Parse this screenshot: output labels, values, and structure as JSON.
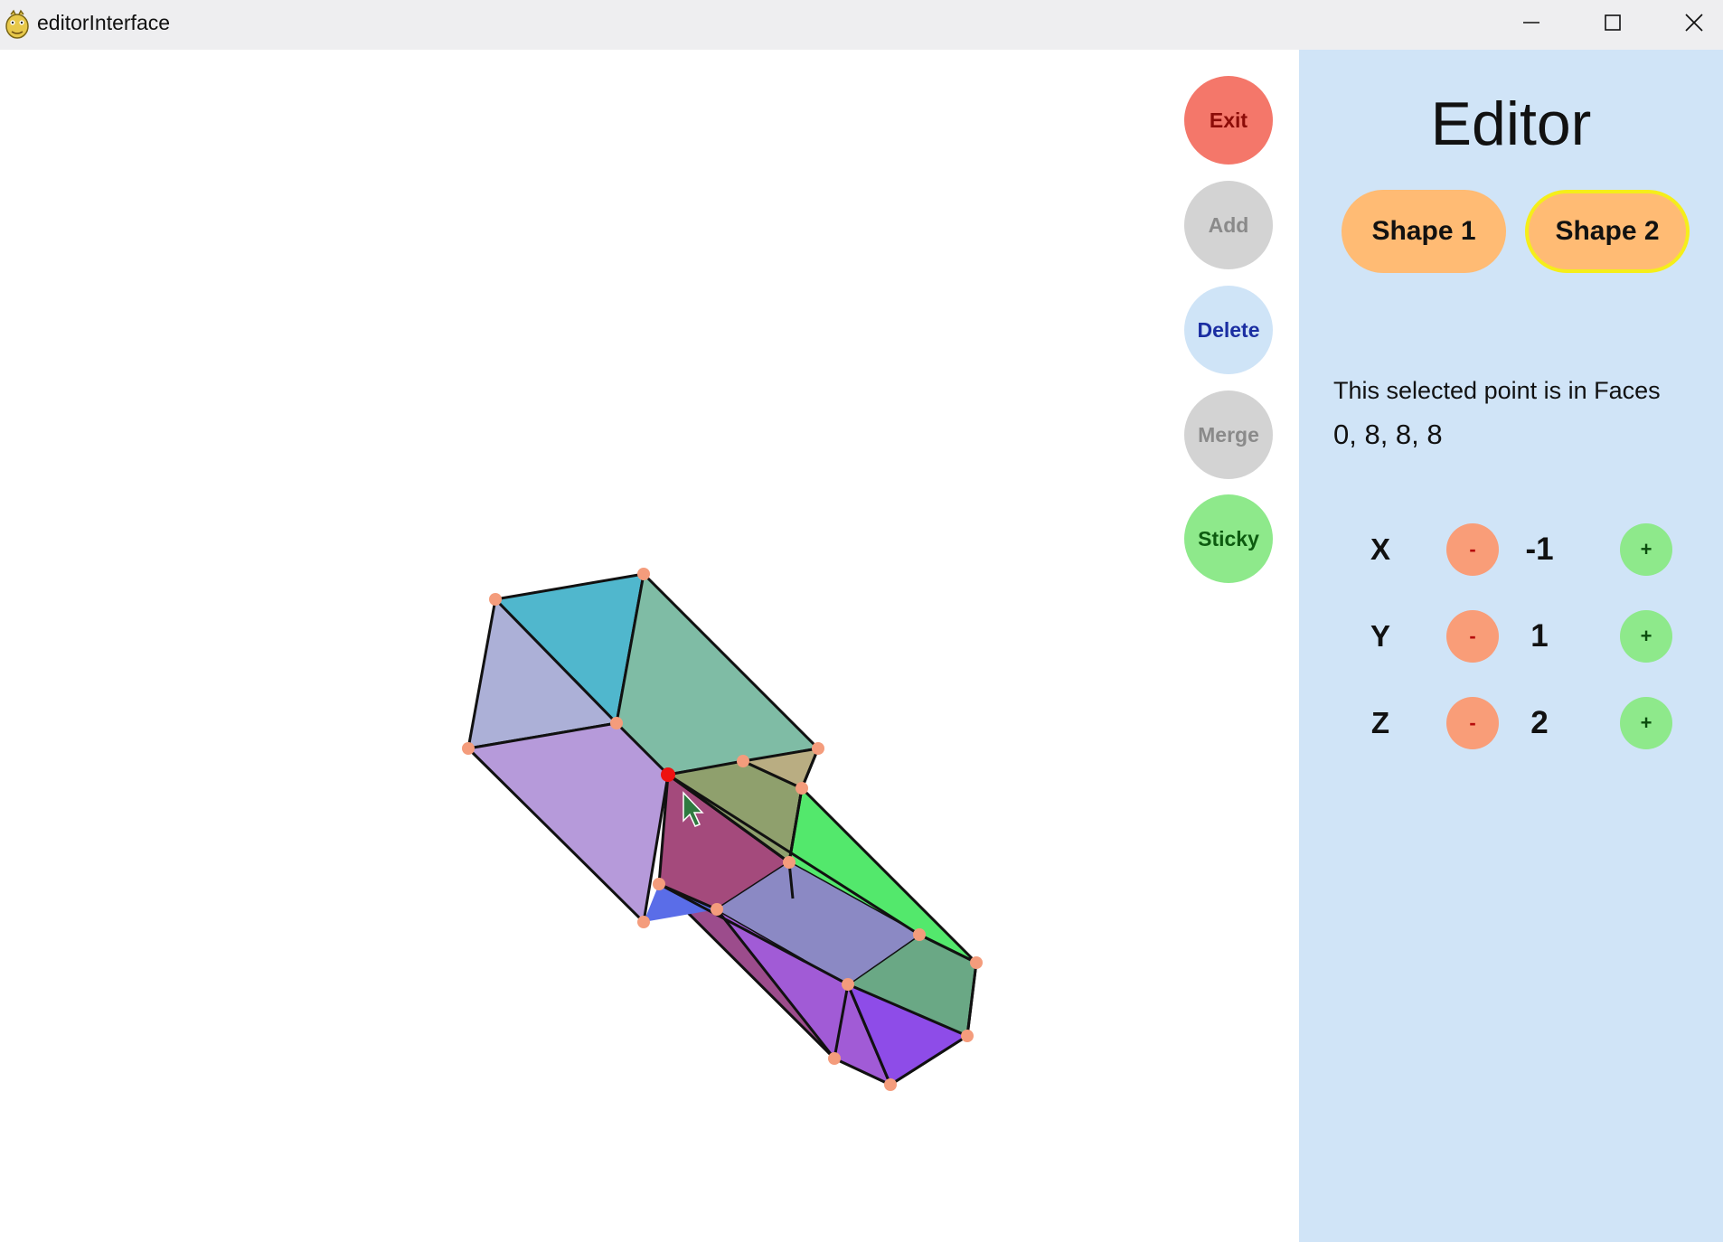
{
  "window": {
    "title": "editorInterface",
    "app_icon": "python-snake-icon",
    "controls": {
      "minimize": "minimize-icon",
      "maximize": "maximize-icon",
      "close": "close-icon"
    }
  },
  "tools": {
    "exit": "Exit",
    "add": "Add",
    "delete": "Delete",
    "merge": "Merge",
    "sticky": "Sticky"
  },
  "editor": {
    "title": "Editor",
    "shapes": [
      {
        "label": "Shape 1",
        "selected": false
      },
      {
        "label": "Shape 2",
        "selected": true
      }
    ],
    "info_line1": "This selected point is in Faces",
    "info_line2": "0, 8, 8, 8",
    "coords": [
      {
        "axis": "X",
        "minus": "-",
        "value": "-1",
        "plus": "+"
      },
      {
        "axis": "Y",
        "minus": "-",
        "value": "1",
        "plus": "+"
      },
      {
        "axis": "Z",
        "minus": "-",
        "value": "2",
        "plus": "+"
      }
    ]
  },
  "colors": {
    "panel_bg": "#d0e4f7",
    "exit": "#f4776a",
    "add": "#d3d3d3",
    "delete": "#cfe4f7",
    "merge": "#d3d3d3",
    "sticky": "#8ee98b",
    "shape_button": "#ffbb74",
    "shape_selected_border": "#f5ee1a",
    "minus_button": "#f99d78",
    "plus_button": "#8ee98b",
    "vertex": "#f49c7c",
    "selected_vertex": "#ee1111"
  }
}
